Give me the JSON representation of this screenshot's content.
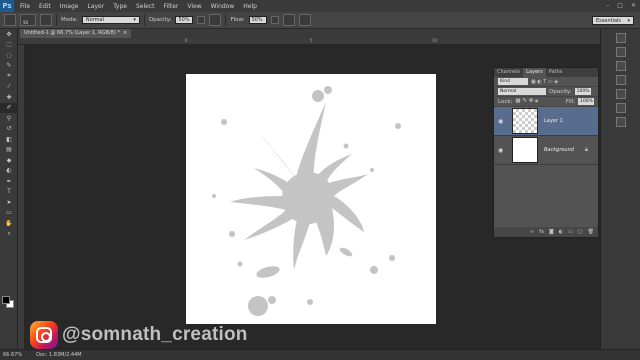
{
  "app": {
    "logo": "Ps"
  },
  "menu": [
    "File",
    "Edit",
    "Image",
    "Layer",
    "Type",
    "Select",
    "Filter",
    "View",
    "Window",
    "Help"
  ],
  "window_controls": [
    "–",
    "□",
    "✕"
  ],
  "options": {
    "brush_size": "50",
    "mode_label": "Mode:",
    "mode_value": "Normal",
    "opacity_label": "Opacity:",
    "opacity_value": "50%",
    "flow_label": "Flow:",
    "flow_value": "50%",
    "workspace": "Essentials"
  },
  "document_tab": {
    "title": "Untitled-1 @ 66.7% (Layer 1, RGB/8) *",
    "close": "×"
  },
  "ruler_ticks": [
    "0",
    "5",
    "10"
  ],
  "status": {
    "zoom": "66.67%",
    "doc_size": "Doc: 1.83M/2.44M"
  },
  "layers_panel": {
    "tabs": [
      "Channels",
      "Layers",
      "Paths"
    ],
    "active_tab": "Layers",
    "kind_label": "Kind",
    "blend_mode": "Normal",
    "opacity_label": "Opacity:",
    "opacity_value": "100%",
    "lock_label": "Lock:",
    "fill_label": "Fill:",
    "fill_value": "100%",
    "layers": [
      {
        "name": "Layer 1",
        "selected": true
      },
      {
        "name": "Background",
        "selected": false
      }
    ],
    "footer_icons": [
      "link-icon",
      "fx-icon",
      "mask-icon",
      "adjustment-icon",
      "folder-icon",
      "new-layer-icon",
      "trash-icon"
    ]
  },
  "watermark": {
    "text": "@somnath_creation"
  },
  "colors": {
    "splatter": "#c4c4c4",
    "canvas": "#ffffff",
    "selected_layer": "#586c8e"
  }
}
